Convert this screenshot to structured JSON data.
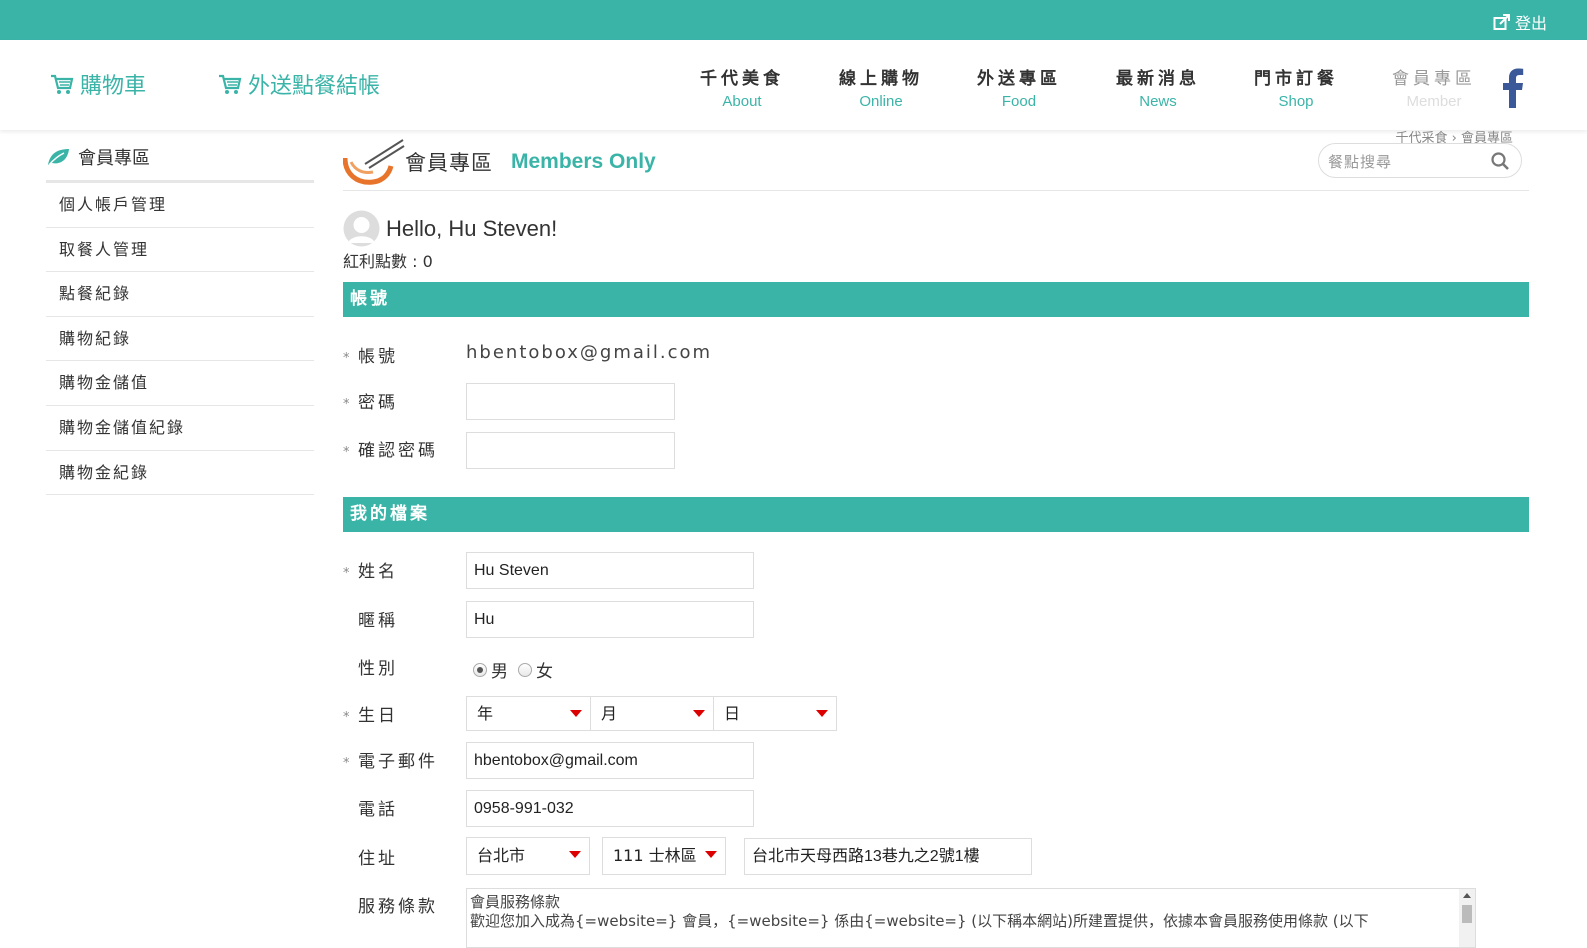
{
  "topbar": {
    "logout_label": "登出"
  },
  "header": {
    "cart_label": "購物車",
    "delivery_checkout_label": "外送點餐結帳",
    "nav": [
      {
        "zh": "千代美食",
        "en": "About"
      },
      {
        "zh": "線上購物",
        "en": "Online"
      },
      {
        "zh": "外送專區",
        "en": "Food"
      },
      {
        "zh": "最新消息",
        "en": "News"
      },
      {
        "zh": "門市訂餐",
        "en": "Shop"
      },
      {
        "zh": "會員專區",
        "en": "Member"
      }
    ]
  },
  "sidebar": {
    "title": "會員專區",
    "items": [
      {
        "label": "個人帳戶管理"
      },
      {
        "label": "取餐人管理"
      },
      {
        "label": "點餐紀錄"
      },
      {
        "label": "購物紀錄"
      },
      {
        "label": "購物金儲值"
      },
      {
        "label": "購物金儲值紀錄"
      },
      {
        "label": "購物金紀錄"
      }
    ]
  },
  "main": {
    "breadcrumb": "千代采食 › 會員專區",
    "title_zh": "會員專區",
    "title_en": "Members Only",
    "search_placeholder": "餐點搜尋",
    "greeting": "Hello, Hu Steven!",
    "points": "紅利點數 : 0"
  },
  "account_section": {
    "heading": "帳號",
    "account_label": "帳號",
    "account_value": "hbentobox@gmail.com",
    "password_label": "密碼",
    "password_value": "",
    "confirm_label": "確認密碼",
    "confirm_value": ""
  },
  "profile_section": {
    "heading": "我的檔案",
    "name_label": "姓名",
    "name_value": "Hu Steven",
    "nickname_label": "暱稱",
    "nickname_value": "Hu",
    "gender_label": "性別",
    "gender_options": [
      "男",
      "女"
    ],
    "gender_selected": "男",
    "birthday_label": "生日",
    "birthday_year": "年",
    "birthday_month": "月",
    "birthday_day": "日",
    "email_label": "電子郵件",
    "email_value": "hbentobox@gmail.com",
    "phone_label": "電話",
    "phone_value": "0958-991-032",
    "address_label": "住址",
    "city_value": "台北市",
    "district_value": "111 士林區",
    "street_value": "台北市天母西路13巷九之2號1樓",
    "terms_label": "服務條款",
    "terms_line1": "會員服務條款",
    "terms_line2": "歡迎您加入成為{=website=} 會員，{=website=} 係由{=website=} (以下稱本網站)所建置提供，依據本會員服務使用條款 (以下"
  },
  "colors": {
    "accent": "#3bb4a8",
    "facebook": "#3b5998",
    "caret": "#dd0000"
  }
}
